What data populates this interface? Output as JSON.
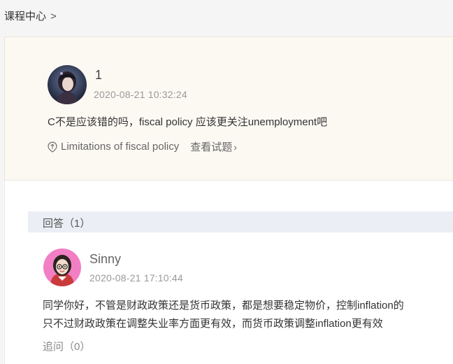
{
  "breadcrumb": {
    "label": "课程中心",
    "separator": ">"
  },
  "question": {
    "username": "1",
    "timestamp": "2020-08-21 10:32:24",
    "text": "C不是应该错的吗，fiscal policy 应该更关注unemployment吧",
    "knowledge_point": "Limitations of fiscal policy",
    "view_question_label": "查看试题",
    "view_question_chevron": "›"
  },
  "answers": {
    "header_label": "回答（1）",
    "items": [
      {
        "username": "Sinny",
        "timestamp": "2020-08-21 17:10:44",
        "text_line1": "同学你好，不管是财政政策还是货币政策，都是想要稳定物价，控制inflation的",
        "text_line2": "只不过财政政策在调整失业率方面更有效，而货币政策调整inflation更有效",
        "followup_label": "追问（0）"
      }
    ]
  },
  "colors": {
    "question_card_bg": "#fcf9f3",
    "answer_bar_bg": "#eceef5",
    "page_bg": "#f5f5f5"
  }
}
